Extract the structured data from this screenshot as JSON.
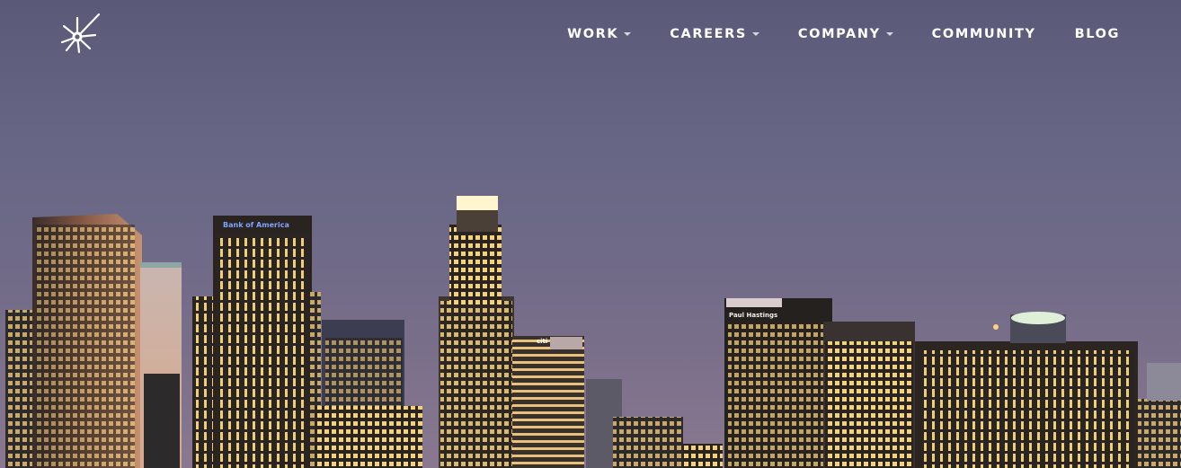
{
  "nav": {
    "items": [
      {
        "label": "WORK",
        "has_dropdown": true,
        "icon": "caret-down-icon"
      },
      {
        "label": "CAREERS",
        "has_dropdown": true,
        "icon": "caret-down-icon"
      },
      {
        "label": "COMPANY",
        "has_dropdown": true,
        "icon": "caret-down-icon"
      },
      {
        "label": "COMMUNITY",
        "has_dropdown": false
      },
      {
        "label": "BLOG",
        "has_dropdown": false
      }
    ]
  },
  "logo": {
    "icon": "starburst-logo-icon"
  },
  "hero": {
    "scene": "city-skyline-at-dusk",
    "signs": {
      "bank_of_america": "Bank of America",
      "paul_hastings": "Paul Hastings",
      "citi": "citi"
    }
  },
  "colors": {
    "sky_top": "#5a5a78",
    "sky_bottom": "#8a7890",
    "nav_text": "#ffffff",
    "window_light": "#f2d27a"
  }
}
